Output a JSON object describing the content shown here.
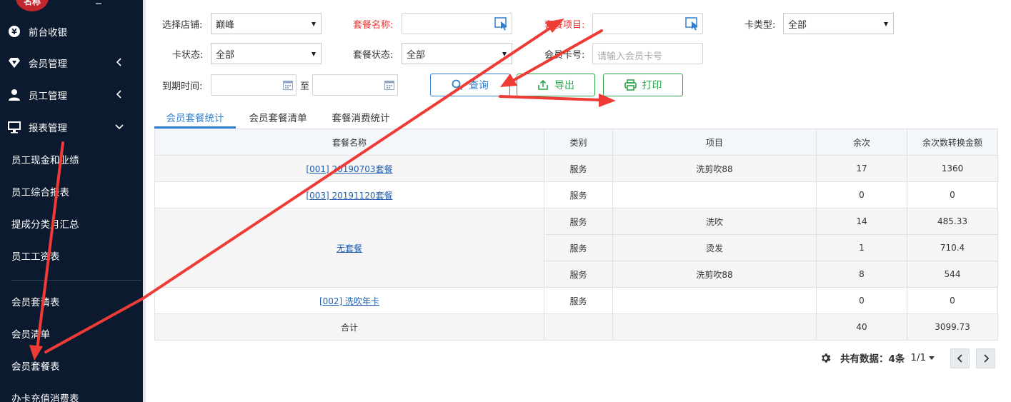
{
  "sidebar": {
    "logo_text": "名称",
    "items": [
      {
        "label": "前台收银",
        "icon": "yen-icon"
      },
      {
        "label": "会员管理",
        "icon": "diamond-icon"
      },
      {
        "label": "员工管理",
        "icon": "user-icon"
      },
      {
        "label": "报表管理",
        "icon": "monitor-icon"
      }
    ],
    "sub_items": [
      "员工现金和业绩",
      "员工综合报表",
      "提成分类月汇总",
      "员工工资表",
      "会员套清表",
      "会员清单",
      "会员套餐表",
      "办卡充值消费表"
    ]
  },
  "filters": {
    "store_label": "选择店铺:",
    "store_value": "巅峰",
    "package_name_label": "套餐名称:",
    "package_item_label": "套餐项目:",
    "card_type_label": "卡类型:",
    "card_type_value": "全部",
    "card_status_label": "卡状态:",
    "card_status_value": "全部",
    "package_status_label": "套餐状态:",
    "package_status_value": "全部",
    "member_card_label": "会员卡号:",
    "member_card_placeholder": "请输入会员卡号",
    "expire_label": "到期时间:",
    "expire_to": "至"
  },
  "buttons": {
    "query": "查询",
    "export": "导出",
    "print": "打印"
  },
  "tabs": [
    "会员套餐统计",
    "会员套餐清单",
    "套餐消费统计"
  ],
  "table": {
    "headers": [
      "套餐名称",
      "类别",
      "项目",
      "余次",
      "余次数转换金额"
    ],
    "rows": [
      {
        "name": "[001] 20190703套餐",
        "category": "服务",
        "item": "洗剪吹88",
        "remaining": "17",
        "amount": "1360"
      },
      {
        "name": "[003] 20191120套餐",
        "category": "服务",
        "item": "",
        "remaining": "0",
        "amount": "0"
      },
      {
        "name": "无套餐",
        "category": "服务",
        "item": "洗吹",
        "remaining": "14",
        "amount": "485.33"
      },
      {
        "name": "",
        "category": "服务",
        "item": "烫发",
        "remaining": "1",
        "amount": "710.4"
      },
      {
        "name": "",
        "category": "服务",
        "item": "洗剪吹88",
        "remaining": "8",
        "amount": "544"
      },
      {
        "name": "[002] 洗吹年卡",
        "category": "服务",
        "item": "",
        "remaining": "0",
        "amount": "0"
      }
    ],
    "total": {
      "label": "合计",
      "remaining": "40",
      "amount": "3099.73"
    }
  },
  "pager": {
    "total_label": "共有数据：",
    "total_count": "4条",
    "pages": "1/1"
  },
  "colors": {
    "sidebar_bg": "#0b1a2e",
    "accent_blue": "#2f7fd0",
    "print_green": "#2aa54a",
    "arrow_red": "#ef3b36"
  }
}
